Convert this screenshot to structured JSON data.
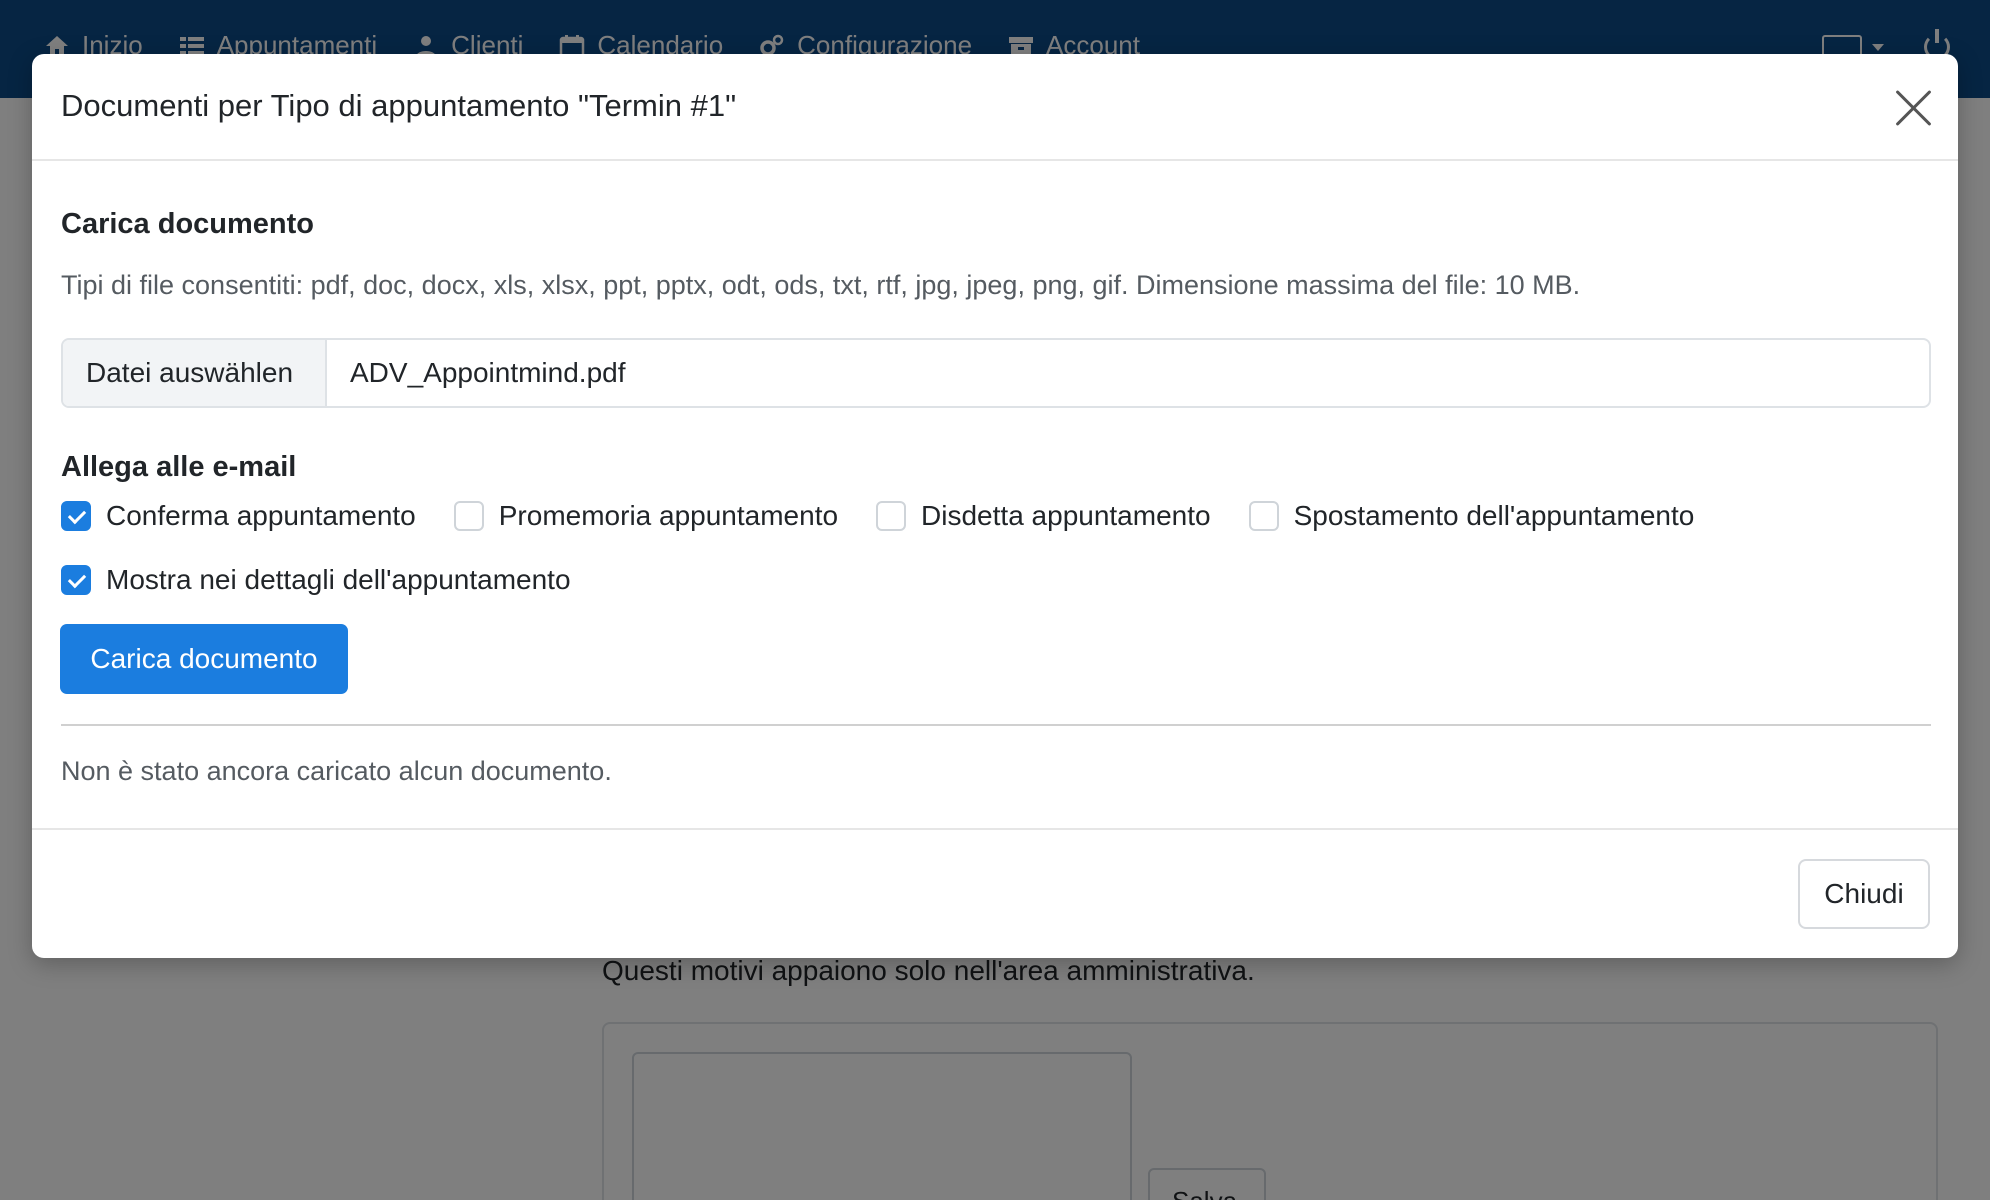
{
  "navbar": {
    "items": [
      {
        "label": "Inizio",
        "icon": "home-icon"
      },
      {
        "label": "Appuntamenti",
        "icon": "list-icon"
      },
      {
        "label": "Clienti",
        "icon": "user-icon"
      },
      {
        "label": "Calendario",
        "icon": "calendar-icon"
      },
      {
        "label": "Configurazione",
        "icon": "gears-icon"
      },
      {
        "label": "Account",
        "icon": "archive-icon"
      }
    ]
  },
  "background": {
    "note": "Questi motivi appaiono solo nell'area amministrativa.",
    "button_label": "Salva"
  },
  "modal": {
    "title": "Documenti per Tipo di appuntamento \"Termin #1\"",
    "upload_section_title": "Carica documento",
    "allowed_types_text": "Tipi di file consentiti: pdf, doc, docx, xls, xlsx, ppt, pptx, odt, ods, txt, rtf, jpg, jpeg, png, gif. Dimensione massima del file: 10 MB.",
    "file_button_label": "Datei auswählen",
    "file_name": "ADV_Appointmind.pdf",
    "attach_title": "Allega alle e-mail",
    "checks": [
      {
        "label": "Conferma appuntamento",
        "checked": true
      },
      {
        "label": "Promemoria appuntamento",
        "checked": false
      },
      {
        "label": "Disdetta appuntamento",
        "checked": false
      },
      {
        "label": "Spostamento dell'appuntamento",
        "checked": false
      }
    ],
    "show_details": {
      "label": "Mostra nei dettagli dell'appuntamento",
      "checked": true
    },
    "upload_button_label": "Carica documento",
    "empty_text": "Non è stato ancora caricato alcun documento.",
    "close_button_label": "Chiudi"
  },
  "colors": {
    "navbar": "#0d4a86",
    "primary": "#1b7ddf"
  }
}
